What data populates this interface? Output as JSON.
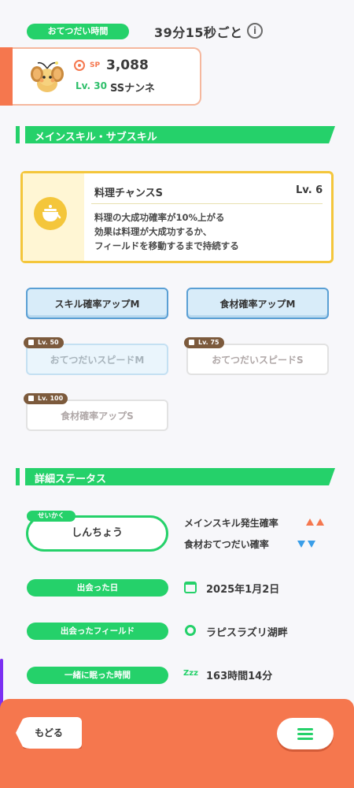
{
  "help": {
    "label": "おてつだい時間",
    "value": "39分15秒ごと",
    "info_glyph": "i"
  },
  "pokemon": {
    "sp_label": "SP",
    "sp_value": "3,088",
    "level": "Lv. 30",
    "name": "SSナンネ",
    "icon": "dedenne-icon"
  },
  "skills_section": {
    "title": "メインスキル・サブスキル"
  },
  "main_skill": {
    "name": "料理チャンスS",
    "level": "Lv. 6",
    "description": [
      "料理の大成功確率が10%上がる",
      "効果は料理が大成功するか、",
      "フィールドを移動するまで持続する"
    ],
    "icon": "cooking-pot-icon"
  },
  "sub_skills": [
    {
      "label": "スキル確率アップM",
      "state": "active"
    },
    {
      "label": "食材確率アップM",
      "state": "active"
    },
    {
      "label": "おてつだいスピードM",
      "state": "locked",
      "unlock": "Lv. 50"
    },
    {
      "label": "おてつだいスピードS",
      "state": "locked",
      "unlock": "Lv. 75"
    },
    {
      "label": "食材確率アップS",
      "state": "locked",
      "unlock": "Lv. 100"
    }
  ],
  "details_section": {
    "title": "詳細ステータス"
  },
  "nature": {
    "label": "せいかく",
    "value": "しんちょう",
    "effect_up": "メインスキル発生確率",
    "effect_down": "食材おてつだい確率"
  },
  "met_date": {
    "label": "出会った日",
    "value": "2025年1月2日"
  },
  "met_field": {
    "label": "出会ったフィールド",
    "value": "ラピスラズリ湖畔"
  },
  "sleep_time": {
    "label": "一緒に眠った時間",
    "value": "163時間14分",
    "icon_text": "Zzz"
  },
  "footer": {
    "back_label": "もどる"
  },
  "colors": {
    "green": "#25d16a",
    "orange": "#f5774e",
    "gold": "#f4c63b",
    "blue": "#5a9fd4"
  }
}
